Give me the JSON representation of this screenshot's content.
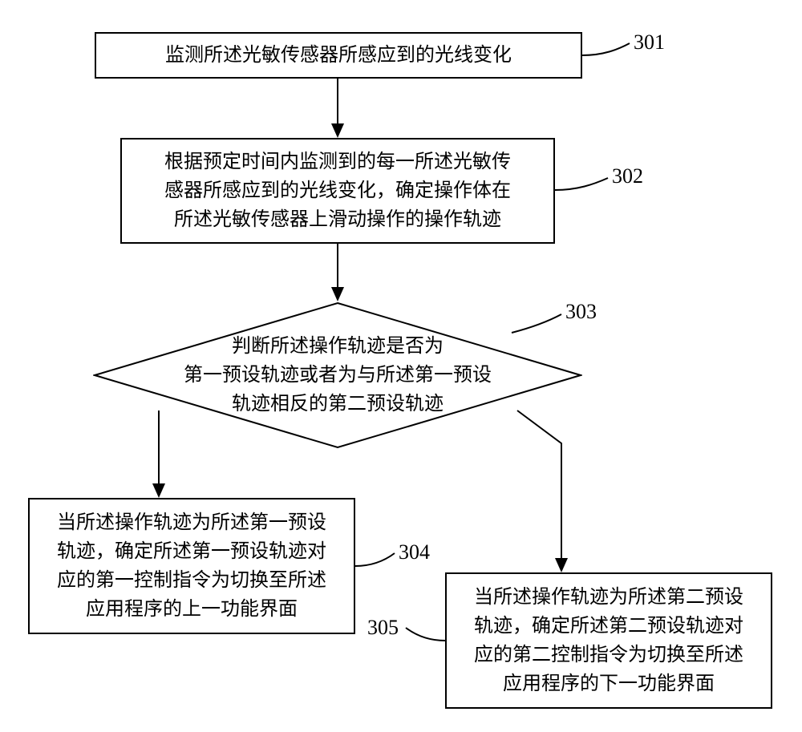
{
  "chart_data": {
    "type": "diagram",
    "nodes": [
      {
        "id": "301",
        "kind": "process",
        "text": "监测所述光敏传感器所感应到的光线变化"
      },
      {
        "id": "302",
        "kind": "process",
        "text": "根据预定时间内监测到的每一所述光敏传感器所感应到的光线变化，确定操作体在所述光敏传感器上滑动操作的操作轨迹"
      },
      {
        "id": "303",
        "kind": "decision",
        "text": "判断所述操作轨迹是否为第一预设轨迹或者为与所述第一预设轨迹相反的第二预设轨迹"
      },
      {
        "id": "304",
        "kind": "process",
        "text": "当所述操作轨迹为所述第一预设轨迹，确定所述第一预设轨迹对应的第一控制指令为切换至所述应用程序的上一功能界面"
      },
      {
        "id": "305",
        "kind": "process",
        "text": "当所述操作轨迹为所述第二预设轨迹，确定所述第二预设轨迹对应的第二控制指令为切换至所述应用程序的下一功能界面"
      }
    ],
    "edges": [
      {
        "from": "301",
        "to": "302"
      },
      {
        "from": "302",
        "to": "303"
      },
      {
        "from": "303",
        "to": "304"
      },
      {
        "from": "303",
        "to": "305"
      }
    ]
  },
  "steps": {
    "s301": {
      "label": "301",
      "text": "监测所述光敏传感器所感应到的光线变化"
    },
    "s302": {
      "label": "302",
      "text": "根据预定时间内监测到的每一所述光敏传\n感器所感应到的光线变化，确定操作体在\n所述光敏传感器上滑动操作的操作轨迹"
    },
    "s303": {
      "label": "303",
      "text": "判断所述操作轨迹是否为\n第一预设轨迹或者为与所述第一预设\n轨迹相反的第二预设轨迹"
    },
    "s304": {
      "label": "304",
      "text": "当所述操作轨迹为所述第一预设\n轨迹，确定所述第一预设轨迹对\n应的第一控制指令为切换至所述\n应用程序的上一功能界面"
    },
    "s305": {
      "label": "305",
      "text": "当所述操作轨迹为所述第二预设\n轨迹，确定所述第二预设轨迹对\n应的第二控制指令为切换至所述\n应用程序的下一功能界面"
    }
  }
}
